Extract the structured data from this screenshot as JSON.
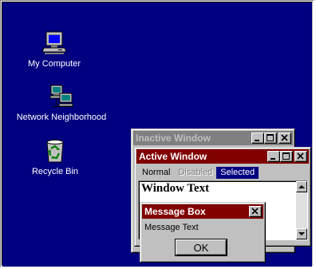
{
  "desktop": {
    "background": "#000080",
    "icons": [
      {
        "label": "My Computer",
        "icon": "computer-icon"
      },
      {
        "label": "Network Neighborhood",
        "icon": "network-icon"
      },
      {
        "label": "Recycle Bin",
        "icon": "recycle-bin-icon"
      }
    ]
  },
  "inactive_window": {
    "title": "Inactive Window",
    "title_bg": "#808080",
    "title_fg": "#c0c0c0"
  },
  "active_window": {
    "title": "Active Window",
    "title_bg": "#800000",
    "title_fg": "#ffffff",
    "menu": {
      "normal": "Normal",
      "disabled": "Disabled",
      "selected": "Selected"
    },
    "window_text": "Window Text",
    "highlight": "#000080"
  },
  "message_box": {
    "title": "Message Box",
    "text": "Message Text",
    "ok_label": "OK"
  }
}
